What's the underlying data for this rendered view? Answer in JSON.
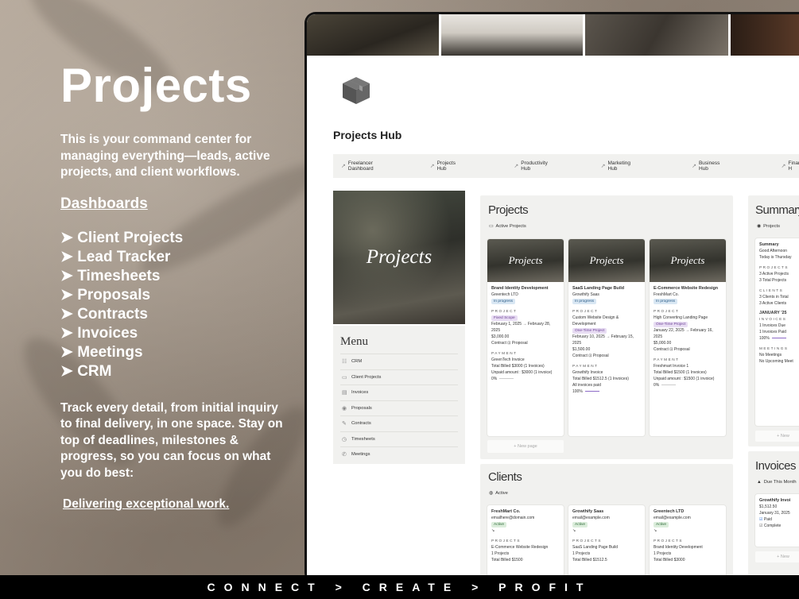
{
  "left": {
    "title": "Projects",
    "intro": "This is your command center for managing everything—leads, active projects, and client workflows.",
    "dashboards_heading": "Dashboards",
    "dashboards": [
      "➤ Client Projects",
      "➤ Lead Tracker",
      "➤ Timesheets",
      "➤ Proposals",
      "➤ Contracts",
      "➤ Invoices",
      "➤ Meetings",
      "➤ CRM"
    ],
    "track": "Track every detail, from initial inquiry to final delivery, in one  space. Stay on top of deadlines, milestones & progress, so you can focus on what you do best:",
    "delivering": "Delivering exceptional work."
  },
  "footer": "CONNECT > CREATE > PROFIT",
  "screen": {
    "page_title": "Projects Hub",
    "nav": [
      "Freelancer Dashboard",
      "Projects Hub",
      "Productivity Hub",
      "Marketing Hub",
      "Business Hub",
      "Finance H"
    ],
    "cover_text": "Projects",
    "menu_title": "Menu",
    "menu": [
      "CRM",
      "Client Projects",
      "Invoices",
      "Proposals",
      "Contracts",
      "Timesheets",
      "Meetings"
    ],
    "projects": {
      "title": "Projects",
      "view": "Active Projects",
      "thumb_text": "Projects",
      "cards": [
        {
          "name": "Brand Identity Development",
          "client": "Greentech LTD",
          "status": "In progress",
          "type": "Fixed Scope",
          "dates": "February 1, 2025 → February 28, 2025",
          "price": "$3,000.00",
          "docs": "Contract ⊡ Proposal",
          "invoice": "GreenTech Invoice",
          "billed": "Total Billed $3000 (1 Invoices)",
          "unpaid": "Unpaid amount : $3000 (1 invoice)",
          "pct": "0%"
        },
        {
          "name": "SaaS Landing Page Build",
          "client": "Growthify Saas",
          "status": "In progress",
          "project": "Custom Website Design & Development",
          "type": "One-Time Project",
          "dates": "February 10, 2025 → February 15, 2025",
          "price": "$1,500.00",
          "docs": "Contract ⊡ Proposal",
          "invoice": "Growthify Invoice",
          "billed": "Total Billed $1512.5 (1 Invoices)",
          "unpaid": "All invoices paid",
          "pct": "100%"
        },
        {
          "name": "E-Commerce Website Redesign",
          "client": "FreshMart Co.",
          "status": "In progress",
          "project": "High Converting Landing Page",
          "type": "One-Time Project",
          "dates": "January 22, 2025 → February 16, 2025",
          "price": "$5,000.00",
          "docs": "Contract ⊡ Proposal",
          "invoice": "Freshmart Invoice 1",
          "billed": "Total Billed $1500 (1 Invoices)",
          "unpaid": "Unpaid amount : $1500 (1 invoice)",
          "pct": "0%"
        }
      ],
      "labels": {
        "project": "PROJECT",
        "payment": "PAYMENT"
      },
      "new_page": "+ New page"
    },
    "clients": {
      "title": "Clients",
      "view": "Active",
      "cards": [
        {
          "name": "FreshMart Co.",
          "email": "emailhere@domain.com",
          "status": "Active",
          "project": "E-Commerce Website Redesign",
          "count": "1 Projects",
          "billed": "Total Billed $1500"
        },
        {
          "name": "Growthify Saas",
          "email": "email@example.com",
          "status": "Active",
          "project": "SaaS Landing Page Build",
          "count": "1 Projects",
          "billed": "Total Billed $1512.5"
        },
        {
          "name": "Greentech LTD",
          "email": "email@example.com",
          "status": "Active",
          "project": "Brand Identity Development",
          "count": "1 Projects",
          "billed": "Total Billed $3000"
        }
      ],
      "label": "PROJECTS"
    },
    "summary": {
      "title": "Summary",
      "view": "Projects",
      "card_title": "Summary",
      "greeting": "Good Afternoon",
      "today": "Today is Thursday",
      "projects_label": "PROJECTS",
      "projects": [
        "3 Active Projects",
        "3 Total Projects"
      ],
      "clients_label": "CLIENTS",
      "clients": [
        "3 Clients in Total",
        "3 Active Clients"
      ],
      "month": "JANUARY '25",
      "invoices_label": "INVOICES",
      "invoices": [
        "1 Invoices Due",
        "1 Invoices Paid"
      ],
      "pct": "100%",
      "meetings_label": "MEETINGS",
      "meetings": [
        "No Meetings",
        "No Upcoming Meet"
      ],
      "new": "+ New"
    },
    "invoices": {
      "title": "Invoices",
      "view": "Due This Month",
      "card": {
        "name": "Growthify Invoi",
        "amount": "$1,512.50",
        "date": "January 31, 2025",
        "paid": "Paid",
        "complete": "Complete"
      },
      "new": "+ New"
    }
  }
}
